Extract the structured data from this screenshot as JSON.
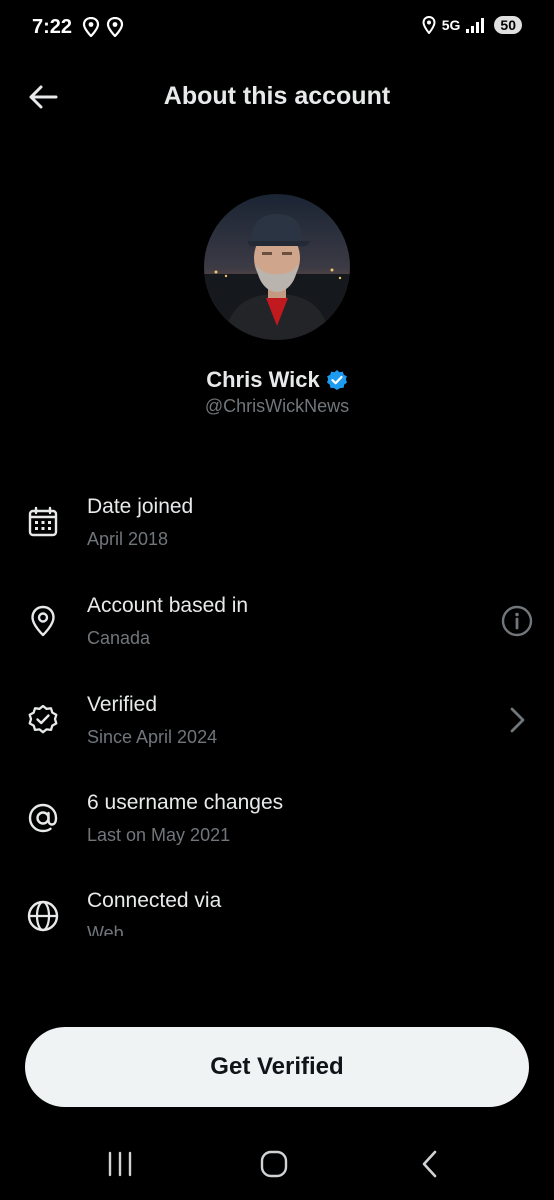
{
  "status_bar": {
    "time": "7:22",
    "network": "5G",
    "battery": "50"
  },
  "header": {
    "title": "About this account"
  },
  "profile": {
    "display_name": "Chris Wick",
    "handle": "@ChrisWickNews",
    "verified_badge_color": "#1d9bf0"
  },
  "info_rows": [
    {
      "icon": "calendar-icon",
      "title": "Date joined",
      "subtitle": "April 2018"
    },
    {
      "icon": "location-pin-icon",
      "title": "Account based in",
      "subtitle": "Canada",
      "trailing": "info-icon"
    },
    {
      "icon": "verified-check-icon",
      "title": "Verified",
      "subtitle": "Since April 2024",
      "trailing": "chevron-right-icon"
    },
    {
      "icon": "at-sign-icon",
      "title": "6 username changes",
      "subtitle": "Last on May 2021"
    },
    {
      "icon": "globe-icon",
      "title": "Connected via",
      "subtitle": "Web"
    }
  ],
  "cta": {
    "label": "Get Verified"
  },
  "colors": {
    "background": "#000000",
    "primary_text": "#e7e9ea",
    "secondary_text": "#71767b",
    "accent": "#1d9bf0",
    "button_bg": "#eff3f4"
  }
}
